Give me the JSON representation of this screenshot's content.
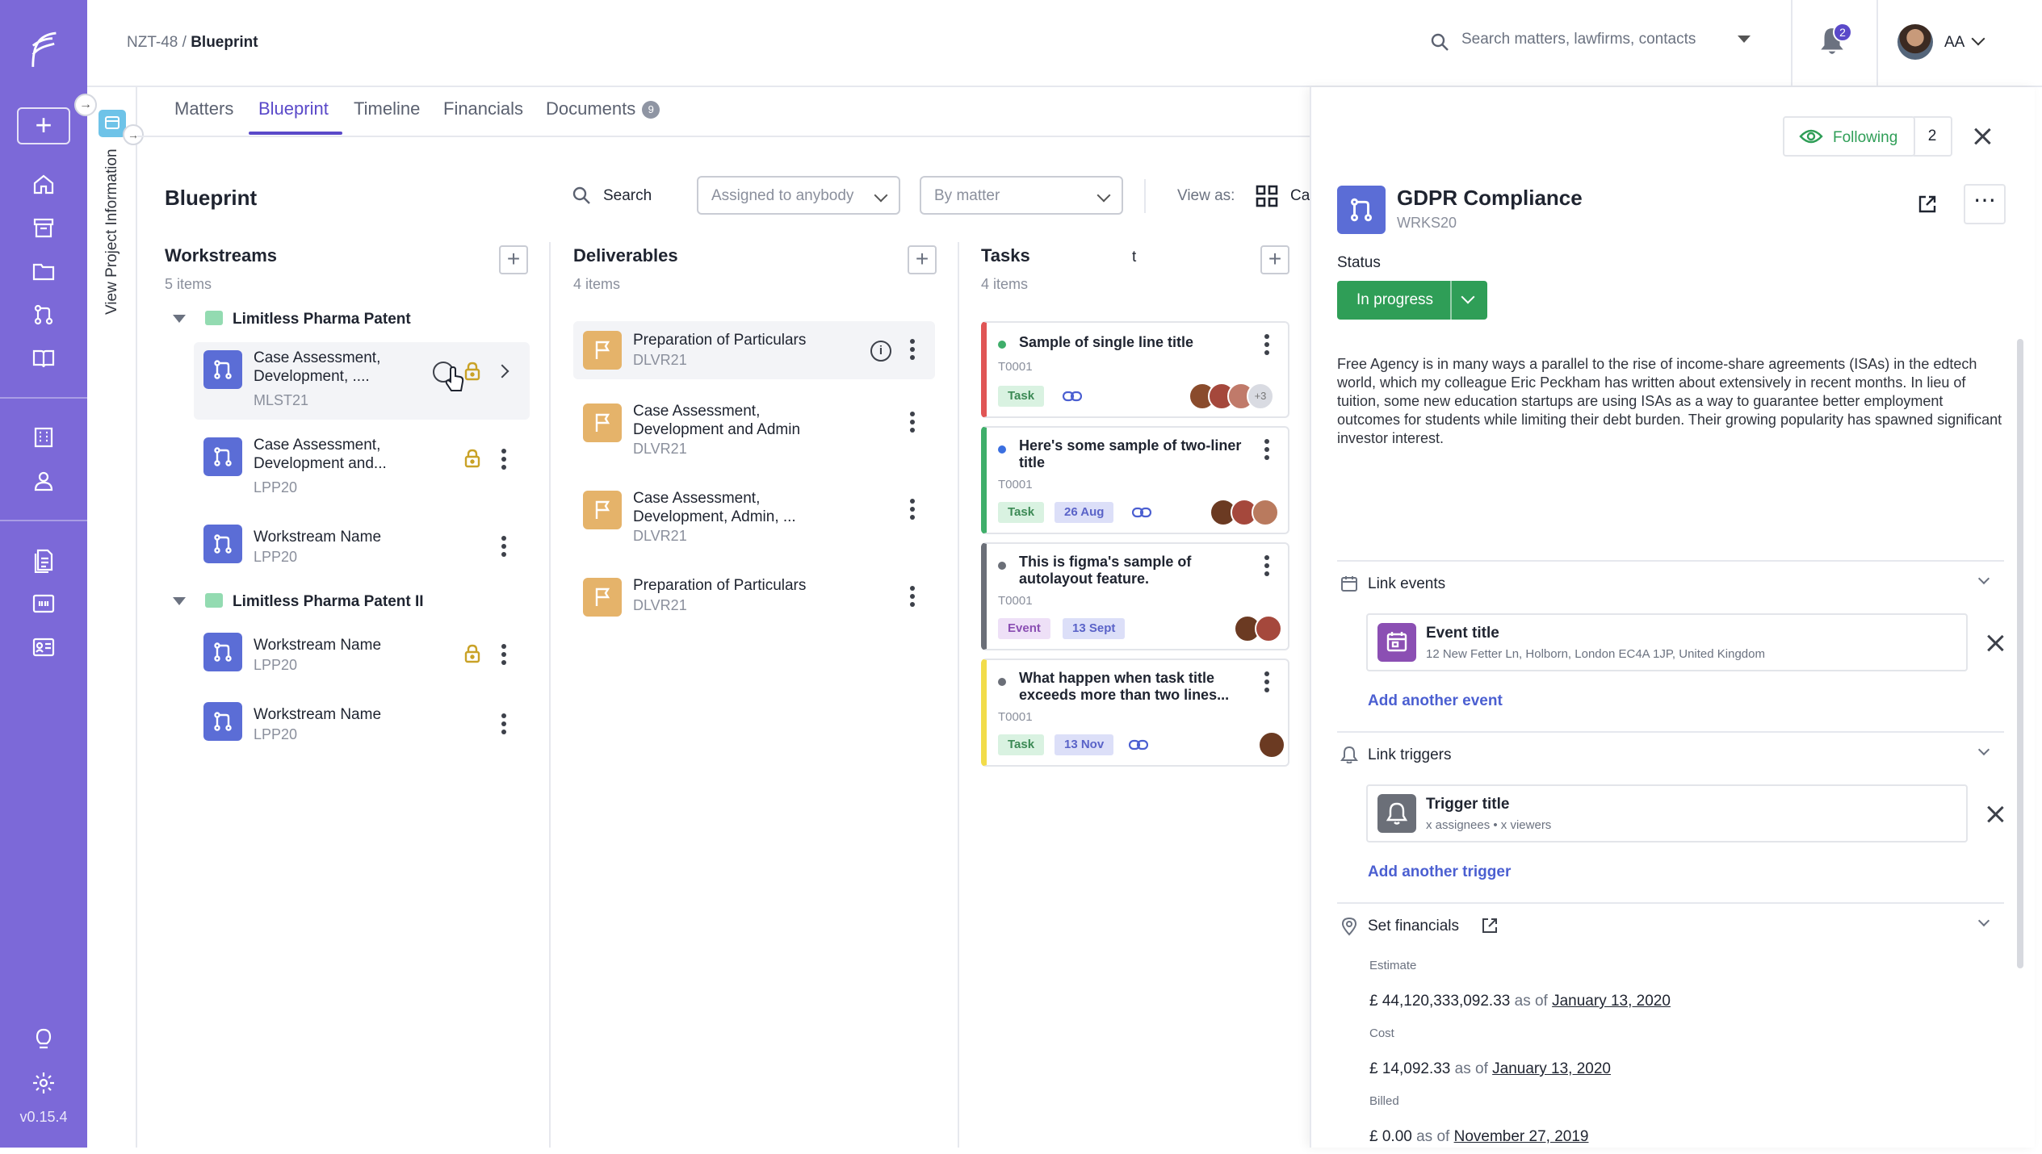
{
  "app": {
    "version": "v0.15.4"
  },
  "breadcrumb": {
    "parent": "NZT-48 /",
    "current": "Blueprint"
  },
  "search": {
    "placeholder": "Search matters, lawfirms, contacts"
  },
  "notifications": {
    "count": "2"
  },
  "user": {
    "initials": "AA"
  },
  "tabs": [
    {
      "label": "Matters"
    },
    {
      "label": "Blueprint",
      "active": true
    },
    {
      "label": "Timeline"
    },
    {
      "label": "Financials"
    },
    {
      "label": "Documents",
      "badge": "9"
    }
  ],
  "project_strip": {
    "label": "View Project Information"
  },
  "board": {
    "title": "Blueprint",
    "search_label": "Search",
    "assigned_filter": "Assigned to anybody",
    "group_filter": "By matter",
    "view_as_label": "View as:",
    "view_as_value": "Ca"
  },
  "workstreams": {
    "title": "Workstreams",
    "count": "5 items",
    "groups": [
      {
        "name": "Limitless Pharma Patent",
        "items": [
          {
            "name": "Case Assessment, Development, ....",
            "code": "MLST21"
          },
          {
            "name": "Case Assessment, Development and...",
            "code": "LPP20"
          },
          {
            "name": "Workstream Name",
            "code": "LPP20"
          }
        ]
      },
      {
        "name": "Limitless Pharma Patent II",
        "items": [
          {
            "name": "Workstream Name",
            "code": "LPP20"
          },
          {
            "name": "Workstream Name",
            "code": "LPP20"
          }
        ]
      }
    ]
  },
  "deliverables": {
    "title": "Deliverables",
    "count": "4 items",
    "items": [
      {
        "name": "Preparation of Particulars",
        "code": "DLVR21"
      },
      {
        "name": "Case Assessment, Development and Admin",
        "code": "DLVR21"
      },
      {
        "name": "Case Assessment, Development, Admin, ...",
        "code": "DLVR21"
      },
      {
        "name": "Preparation of Particulars",
        "code": "DLVR21"
      }
    ]
  },
  "tasks": {
    "title": "Tasks",
    "stray": "t",
    "count": "4 items",
    "items": [
      {
        "title": "Sample of single line title",
        "code": "T0001",
        "type": "Task",
        "extra_avatars": "+3",
        "accent": "#e05555",
        "dot": "#3fae6a"
      },
      {
        "title": "Here's some sample of two-liner title",
        "code": "T0001",
        "type": "Task",
        "date": "26 Aug",
        "accent": "#3fae6a",
        "dot": "#3b6fe0"
      },
      {
        "title": "This is figma's sample of autolayout feature.",
        "code": "T0001",
        "type": "Event",
        "date": "13 Sept",
        "accent": "#6b6f78",
        "dot": "#6b6f78"
      },
      {
        "title": "What happen when task title exceeds more than two lines...",
        "code": "T0001",
        "type": "Task",
        "date": "13 Nov",
        "accent": "#f2dc4a",
        "dot": "#6b6f78"
      }
    ]
  },
  "panel": {
    "following_label": "Following",
    "following_count": "2",
    "title": "GDPR Compliance",
    "code": "WRKS20",
    "status_label": "Status",
    "status_value": "In progress",
    "description": "Free Agency is in many ways a parallel to the rise of income-share agreements (ISAs) in the edtech world, which my colleague Eric Peckham has written about extensively in recent months. In lieu of tuition, some new education startups are using ISAs as a way to guarantee better employment outcomes for students while limiting their debt burden. Their growing popularity has spawned significant investor interest.",
    "link_events": {
      "label": "Link events",
      "event_title": "Event title",
      "event_address": "12 New Fetter Ln, Holborn, London EC4A 1JP, United Kingdom",
      "add": "Add another event"
    },
    "link_triggers": {
      "label": "Link triggers",
      "trigger_title": "Trigger title",
      "trigger_meta": "x assignees • x viewers",
      "add": "Add another trigger"
    },
    "financials": {
      "label": "Set financials",
      "as_of": "as of",
      "estimate": {
        "label": "Estimate",
        "amount": "£ 44,120,333,092.33",
        "date": "January 13, 2020"
      },
      "cost": {
        "label": "Cost",
        "amount": "£ 14,092.33",
        "date": "January 13, 2020"
      },
      "billed": {
        "label": "Billed",
        "amount": "£ 0.00",
        "date": "November 27, 2019"
      }
    }
  },
  "colors": {
    "rail": "#7c69d8",
    "accent": "#5a49c9",
    "status": "#2f9e57",
    "workstream": "#5b6dd6",
    "deliverable": "#e5b36a"
  }
}
